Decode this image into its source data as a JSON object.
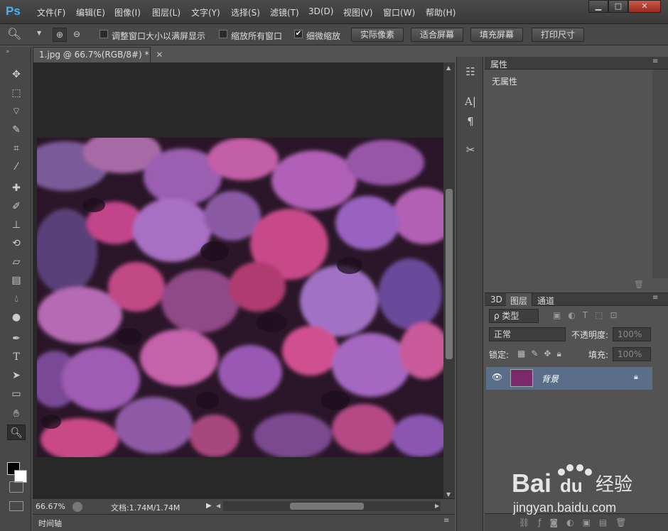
{
  "menubar": {
    "logo": "Ps",
    "items": [
      "文件(F)",
      "编辑(E)",
      "图像(I)",
      "图层(L)",
      "文字(Y)",
      "选择(S)",
      "滤镜(T)",
      "3D(D)",
      "视图(V)",
      "窗口(W)",
      "帮助(H)"
    ],
    "window_buttons": [
      "▁",
      "□",
      "✕"
    ]
  },
  "options": {
    "resize_windows": "调整窗口大小以满屏显示",
    "zoom_all": "缩放所有窗口",
    "scrubby_zoom": "细微缩放",
    "scrubby_checked": true,
    "btn_actual": "实际像素",
    "btn_fit": "适合屏幕",
    "btn_fill": "填充屏幕",
    "btn_print": "打印尺寸"
  },
  "document": {
    "tab_title": "1.jpg @ 66.7%(RGB/8#) *",
    "zoom": "66.67%",
    "doc_size": "文档:1.74M/1.74M"
  },
  "timeline": {
    "label": "时间轴"
  },
  "properties": {
    "tab": "属性",
    "empty": "无属性"
  },
  "layers_panel": {
    "tabs": [
      "3D",
      "图层",
      "通道"
    ],
    "filter_kind": "ρ 类型",
    "blend_mode": "正常",
    "opacity_label": "不透明度:",
    "opacity_value": "100%",
    "lock_label": "锁定:",
    "fill_label": "填充:",
    "fill_value": "100%",
    "layers": [
      {
        "name": "背景",
        "visible": true,
        "locked": true
      }
    ]
  },
  "footer_icons": [
    "link-icon",
    "fx-icon",
    "mask-icon",
    "adjustment-icon",
    "folder-icon",
    "new-layer-icon",
    "trash-icon"
  ],
  "watermark": {
    "brand": "Bai",
    "paw": "du",
    "suffix": "经验",
    "url": "jingyan.baidu.com"
  },
  "colors": {
    "accent": "#49b1f5",
    "selected_layer": "#5a6e89",
    "canvas_bg": "#282828"
  }
}
